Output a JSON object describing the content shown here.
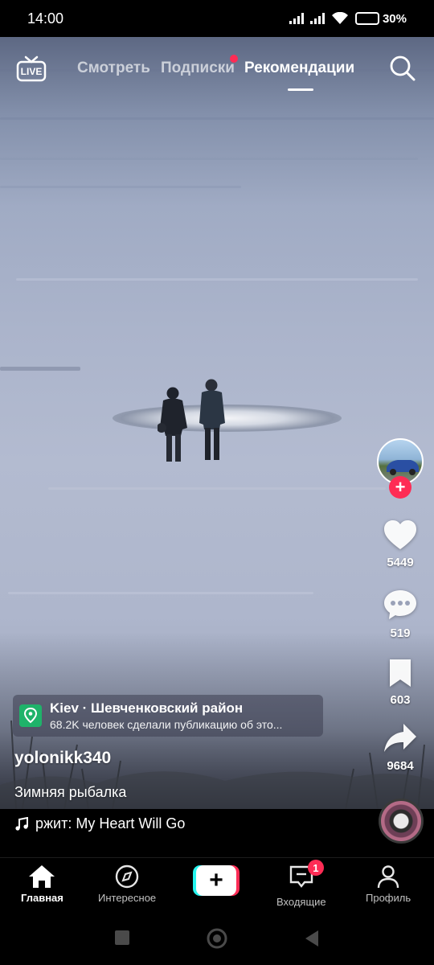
{
  "status_bar": {
    "time": "14:00",
    "battery_percent_text": "30%",
    "battery_level": 0.3
  },
  "top_nav": {
    "live_label": "LIVE",
    "tabs": [
      {
        "label": "Смотреть",
        "active": false
      },
      {
        "label": "Подписки",
        "active": false,
        "has_dot": true
      },
      {
        "label": "Рекомендации",
        "active": true
      }
    ]
  },
  "rail": {
    "likes": "5449",
    "comments": "519",
    "saves": "603",
    "shares": "9684"
  },
  "location": {
    "title": "Kiev · Шевченковский район",
    "subtitle": "68.2K человек сделали публикацию об это..."
  },
  "post": {
    "username": "yolonikk340",
    "caption": "Зимняя рыбалка",
    "music": "ржит: My Heart Will Go"
  },
  "bottom_nav": {
    "home": "Главная",
    "discover": "Интересное",
    "inbox": "Входящие",
    "inbox_badge": "1",
    "profile": "Профиль"
  },
  "colors": {
    "accent_red": "#fe2c55",
    "accent_cyan": "#25f4ee",
    "location_green": "#1fb36a"
  }
}
